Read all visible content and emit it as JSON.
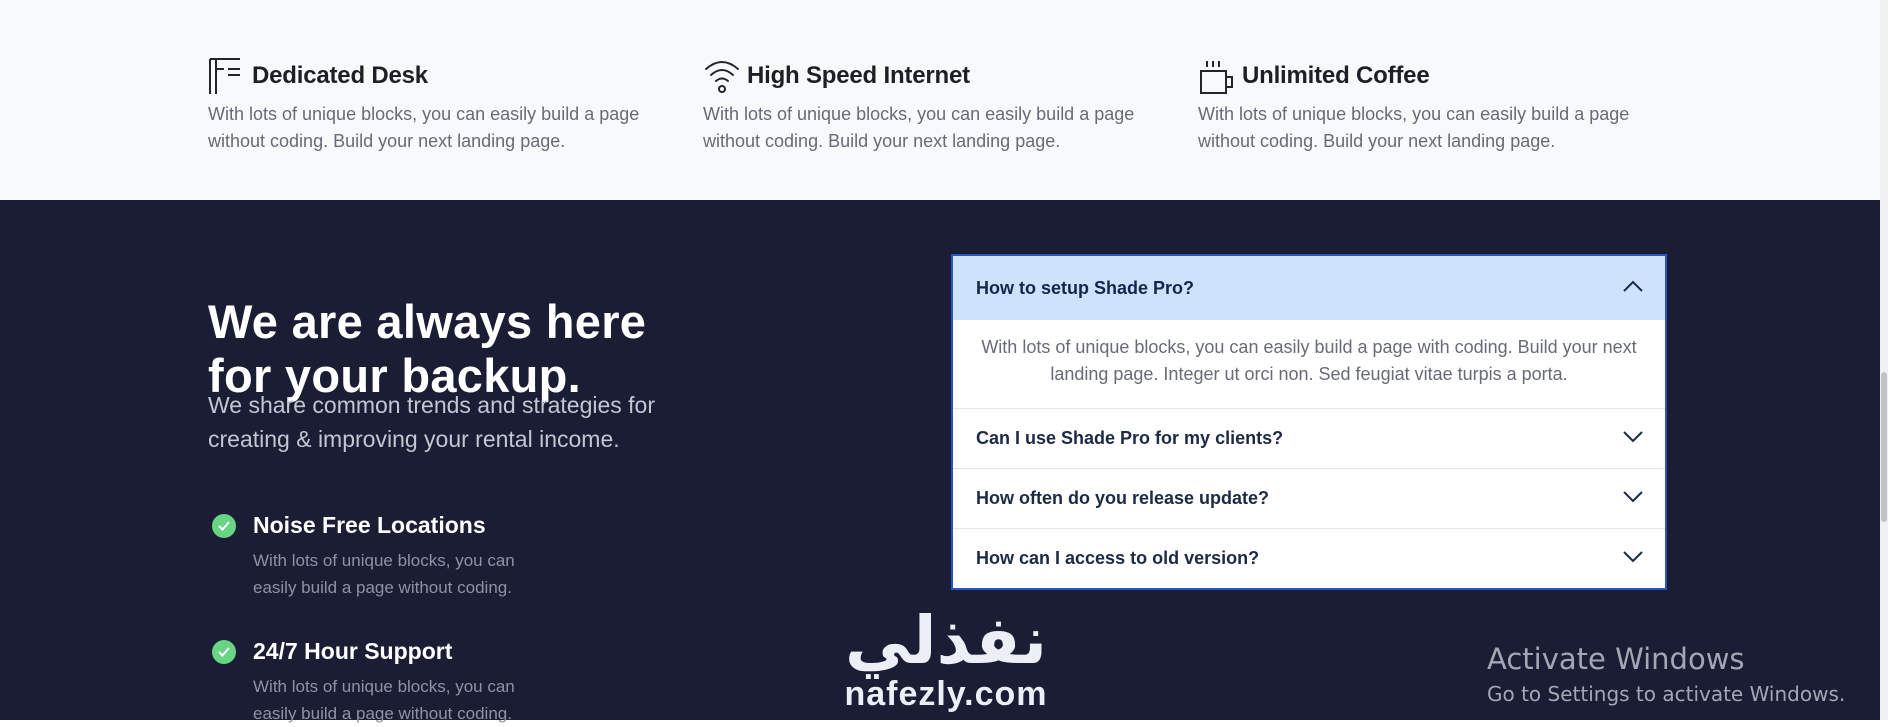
{
  "features": [
    {
      "icon": "desk-icon",
      "title": "Dedicated Desk",
      "desc": "With lots of unique blocks, you can easily build a page without coding. Build your next landing page."
    },
    {
      "icon": "wifi-icon",
      "title": "High Speed Internet",
      "desc": "With lots of unique blocks, you can easily build a page without coding. Build your next landing page."
    },
    {
      "icon": "coffee-icon",
      "title": "Unlimited Coffee",
      "desc": "With lots of unique blocks, you can easily build a page without coding. Build your next landing page."
    }
  ],
  "hero": {
    "heading": "We are always here for your backup.",
    "subtext": "We share common trends and strategies for creating & improving your rental income."
  },
  "points": [
    {
      "title": "Noise Free Locations",
      "desc": "With lots of unique blocks, you can easily build a page without coding."
    },
    {
      "title": "24/7 Hour Support",
      "desc": "With lots of unique blocks, you can easily build a page without coding."
    }
  ],
  "faq": [
    {
      "question": "How to setup Shade Pro?",
      "answer": "With lots of unique blocks, you can easily build a page with coding. Build your next landing page. Integer ut orci non. Sed feugiat vitae turpis a porta.",
      "open": true
    },
    {
      "question": "Can I use Shade Pro for my clients?",
      "open": false
    },
    {
      "question": "How often do you release update?",
      "open": false
    },
    {
      "question": "How can I access to old version?",
      "open": false
    }
  ],
  "watermark": {
    "arabic": "نفذلي",
    "latin": "nafezly.com"
  },
  "os_notice": {
    "title": "Activate Windows",
    "subtitle": "Go to Settings to activate Windows."
  },
  "colors": {
    "dark_bg": "#1b1d35",
    "accent_open": "#cfe2fb",
    "check": "#68d585"
  }
}
